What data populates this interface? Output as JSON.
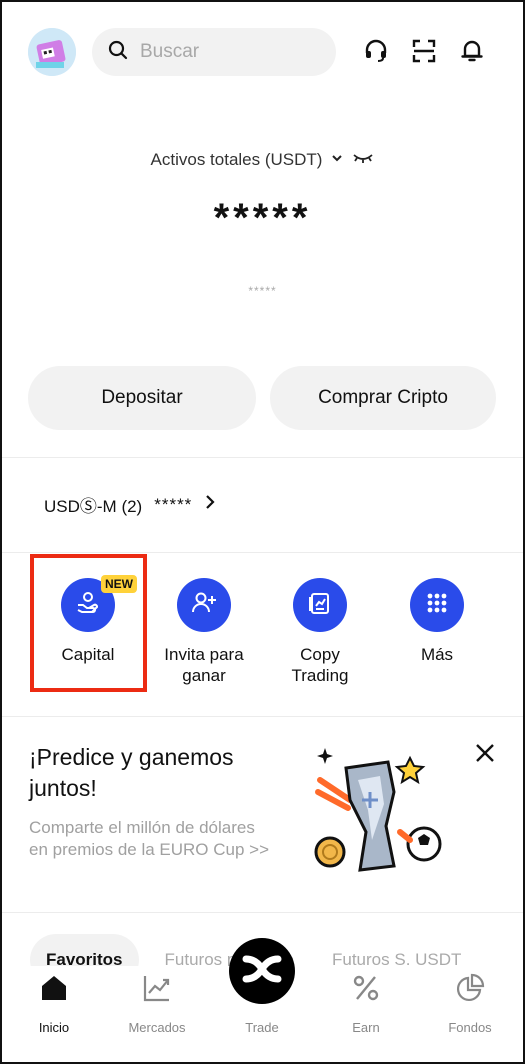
{
  "header": {
    "search_placeholder": "Buscar",
    "icons": [
      "avatar",
      "search-icon",
      "support-headset-icon",
      "scan-icon",
      "bell-icon"
    ]
  },
  "balance": {
    "label": "Activos totales (USDT)",
    "value": "*****",
    "sub_value": "*****"
  },
  "actions": {
    "deposit": "Depositar",
    "buy": "Comprar Cripto"
  },
  "account": {
    "name": "USDⓈ-M (2)",
    "value": "*****"
  },
  "shortcuts": [
    {
      "label": "Capital",
      "badge": "NEW",
      "icon": "hand-coin-icon"
    },
    {
      "label": "Invita para ganar",
      "icon": "add-user-icon"
    },
    {
      "label": "Copy Trading",
      "icon": "copy-chart-icon"
    },
    {
      "label": "Más",
      "icon": "grid-dots-icon"
    }
  ],
  "promo": {
    "title": "¡Predice y ganemos juntos!",
    "subtitle": "Comparte el millón de dólares en premios de la EURO Cup >>"
  },
  "tabs": [
    "Favoritos",
    "Futuros perpetuo",
    "Futuros S. USDT"
  ],
  "bottom_nav": [
    {
      "label": "Inicio",
      "icon": "home-icon",
      "active": true
    },
    {
      "label": "Mercados",
      "icon": "chart-line-icon"
    },
    {
      "label": "Trade",
      "icon": "trade-x-icon"
    },
    {
      "label": "Earn",
      "icon": "percent-icon"
    },
    {
      "label": "Fondos",
      "icon": "pie-chart-icon"
    }
  ],
  "colors": {
    "accent": "#2a4bea",
    "highlight": "#ec2b13",
    "badge": "#ffd23a"
  }
}
